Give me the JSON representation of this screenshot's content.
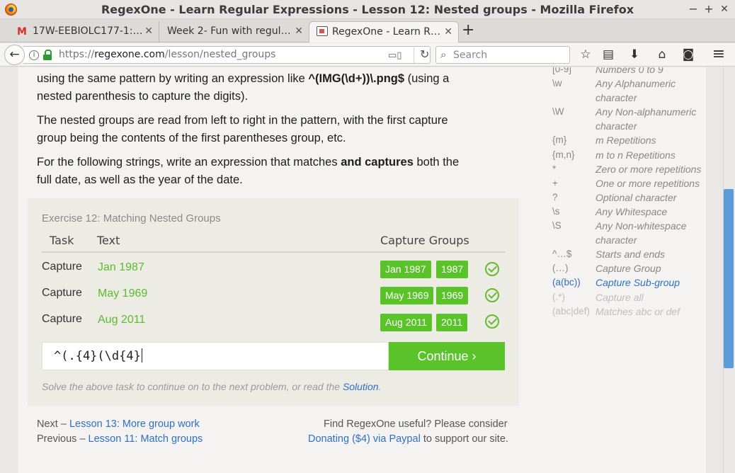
{
  "window": {
    "title": "RegexOne - Learn Regular Expressions - Lesson 12: Nested groups - Mozilla Firefox",
    "controls": {
      "minimize": "−",
      "maximize": "+",
      "close": "✕"
    }
  },
  "tabs": [
    {
      "label": "17W-EEBIOLC177-1:…",
      "icon": "gmail-icon",
      "close": "✕"
    },
    {
      "label": "Week 2- Fun with regul…",
      "close": "✕"
    },
    {
      "label": "RegexOne - Learn R…",
      "icon": "favicon",
      "close": "✕",
      "active": true
    }
  ],
  "newtab_label": "+",
  "nav": {
    "back": "←",
    "url_prefix": "https://",
    "url_host": "regexone.com",
    "url_path": "/lesson/nested_groups",
    "reader": "▭▯",
    "reload": "↻",
    "search_icon": "⌕",
    "search_placeholder": "Search",
    "icons": {
      "bookmark": "☆",
      "library": "▤",
      "download": "⬇",
      "home": "⌂",
      "pocket": "◙",
      "menu": "≡"
    }
  },
  "lesson": {
    "para1_a": "using the same pattern by writing an expression like ",
    "para1_code": "^(IMG(\\d+))\\.png$",
    "para1_b": " (using a",
    "para1_line2": "nested parenthesis to capture the digits).",
    "para2_line1": "The nested groups are read from left to right in the pattern, with the first capture",
    "para2_line2": "group being the contents of the first parentheses group, etc.",
    "para3_a": "For the following strings, write an expression that matches ",
    "para3_bold": "and captures",
    "para3_b": " both the",
    "para3_line2": "full date, as well as the year of the date."
  },
  "exercise": {
    "title": "Exercise 12: Matching Nested Groups",
    "headers": {
      "task": "Task",
      "text": "Text",
      "capture": "Capture Groups"
    },
    "rows": [
      {
        "task": "Capture",
        "text": "Jan 1987",
        "groups": [
          "Jan 1987",
          "1987"
        ]
      },
      {
        "task": "Capture",
        "text": "May 1969",
        "groups": [
          "May 1969",
          "1969"
        ]
      },
      {
        "task": "Capture",
        "text": "Aug 2011",
        "groups": [
          "Aug 2011",
          "2011"
        ]
      }
    ],
    "input_value": "^(.{4}(\\d{4}",
    "continue_label": "Continue ›",
    "hint_before": "Solve the above task to continue on to the next problem, or read the ",
    "hint_link": "Solution",
    "hint_after": "."
  },
  "footer": {
    "next_prefix": "Next – ",
    "next_link": "Lesson 13: More group work",
    "prev_prefix": "Previous – ",
    "prev_link": "Lesson 11: Match groups",
    "support_line1": "Find RegexOne useful? Please consider",
    "support_link": "Donating ($4) via Paypal",
    "support_after": " to support our site."
  },
  "cheatsheet": [
    {
      "key": "[0-9]",
      "desc": "Numbers 0 to 9"
    },
    {
      "key": "\\w",
      "desc": "Any Alphanumeric"
    },
    {
      "key": "",
      "desc": "character"
    },
    {
      "key": "\\W",
      "desc": "Any Non-alphanumeric"
    },
    {
      "key": "",
      "desc": "character"
    },
    {
      "key": "{m}",
      "desc": "m Repetitions"
    },
    {
      "key": "{m,n}",
      "desc": "m to n Repetitions"
    },
    {
      "key": "*",
      "desc": "Zero or more repetitions"
    },
    {
      "key": "+",
      "desc": "One or more repetitions"
    },
    {
      "key": "?",
      "desc": "Optional character"
    },
    {
      "key": "\\s",
      "desc": "Any Whitespace"
    },
    {
      "key": "\\S",
      "desc": "Any Non-whitespace"
    },
    {
      "key": "",
      "desc": "character"
    },
    {
      "key": "^…$",
      "desc": "Starts and ends"
    },
    {
      "key": "(…)",
      "desc": "Capture Group"
    },
    {
      "key": "(a(bc))",
      "desc": "Capture Sub-group"
    },
    {
      "key": "(.*)",
      "desc": "Capture all"
    },
    {
      "key": "(abc|def)",
      "desc": "Matches abc or def"
    }
  ],
  "colors": {
    "accent_green": "#5ac32a",
    "text_green": "#5dbb2e",
    "link_blue": "#2f6fc4",
    "scroll_blue": "#5a9bd8"
  }
}
